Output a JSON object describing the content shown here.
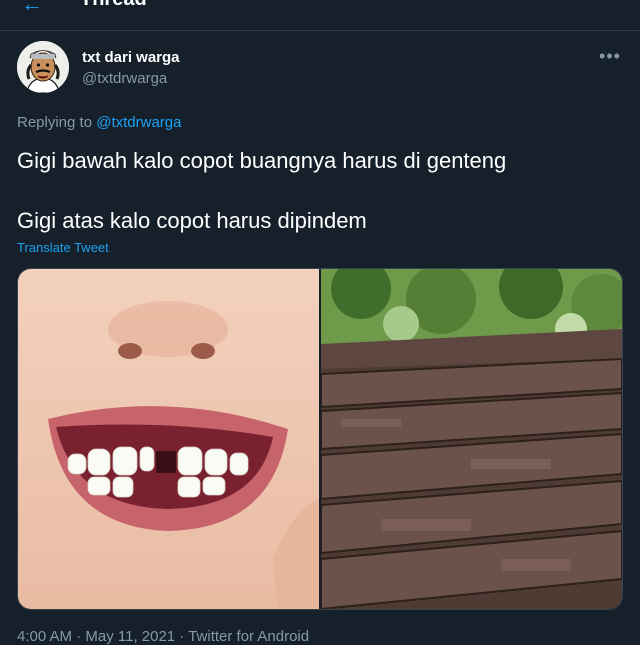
{
  "header": {
    "title": "Thread",
    "back_icon": "arrow-left-icon"
  },
  "tweet": {
    "author": {
      "name": "txt dari warga",
      "handle": "@txtdrwarga"
    },
    "more_icon": "more-horizontal-icon",
    "replying_to_prefix": "Replying to",
    "replying_to_handle": "@txtdrwarga",
    "text_line1": "Gigi bawah kalo copot buangnya harus di genteng",
    "text_line2": "Gigi atas kalo copot harus dipindem",
    "translate_label": "Translate Tweet",
    "images": [
      "child-smile-missing-tooth-photo",
      "roof-tiles-photo"
    ],
    "meta": "4:00 AM · May 11, 2021 · Twitter for Android"
  },
  "colors": {
    "background": "#15202b",
    "accent": "#1da1f2",
    "secondary_text": "#8899a6"
  }
}
